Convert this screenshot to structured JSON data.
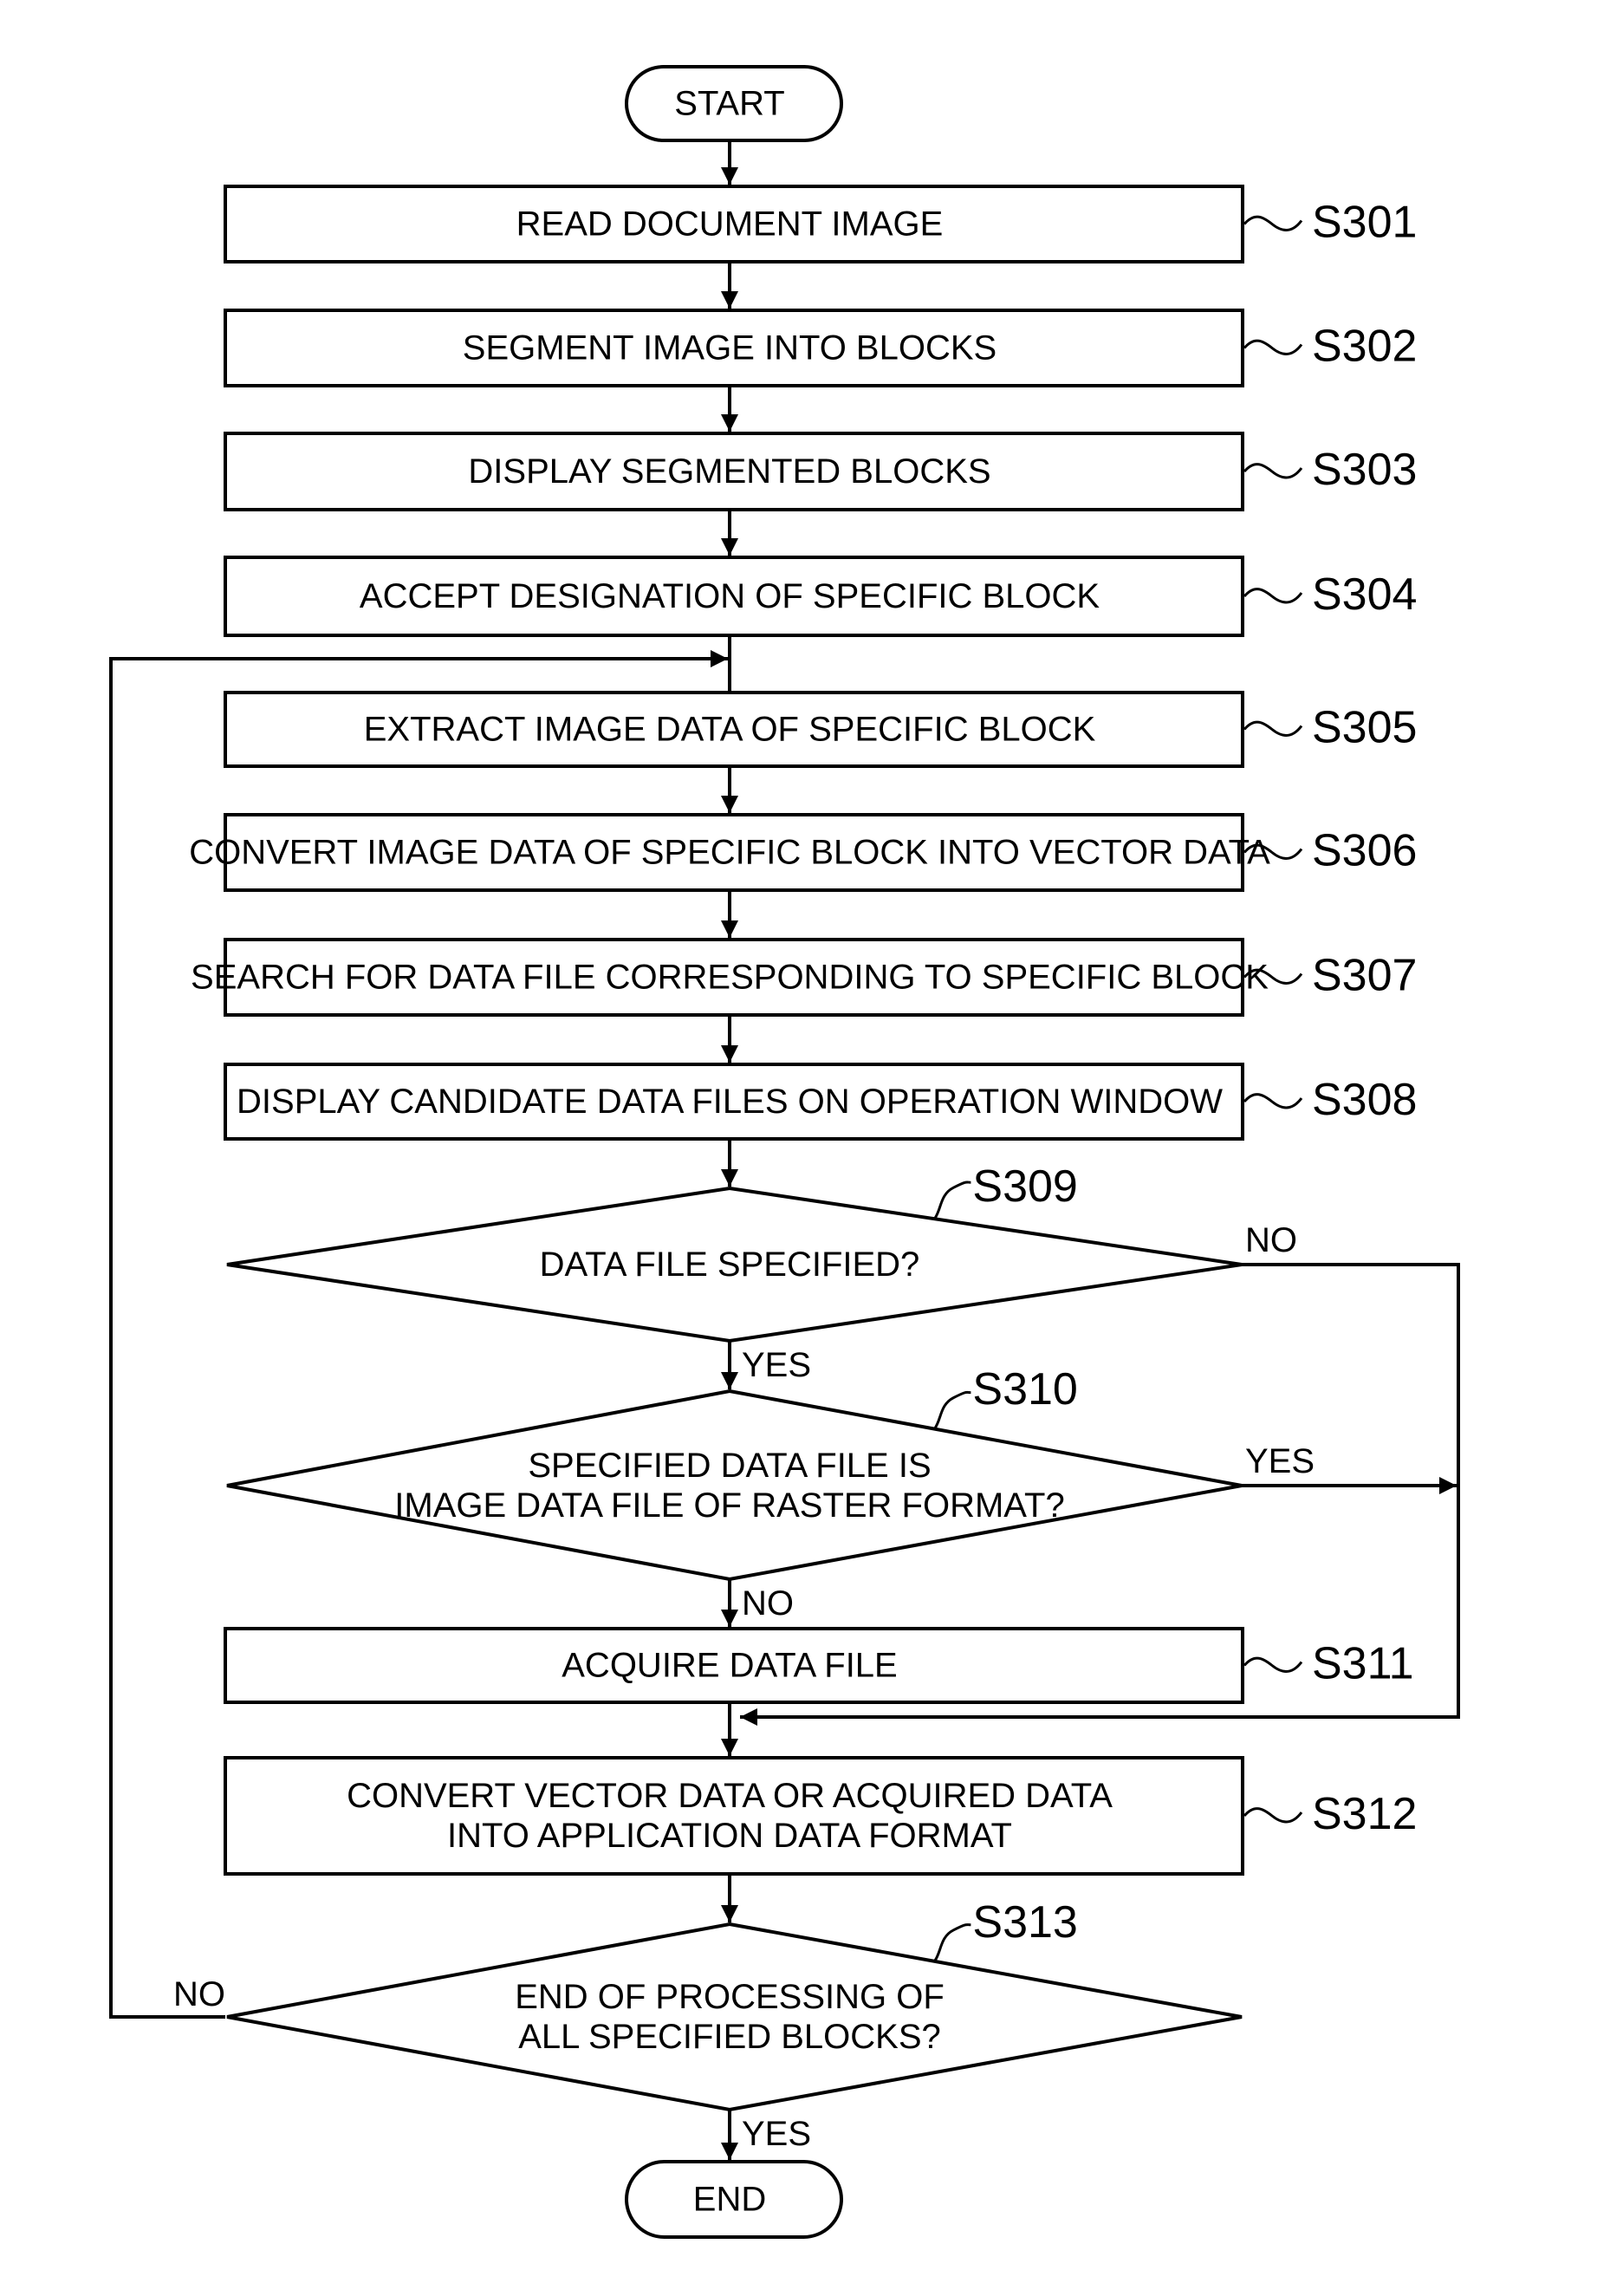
{
  "flowchart": {
    "terminals": {
      "start": "START",
      "end": "END"
    },
    "steps": [
      {
        "id": "S301",
        "lines": [
          "READ DOCUMENT IMAGE"
        ]
      },
      {
        "id": "S302",
        "lines": [
          "SEGMENT IMAGE INTO BLOCKS"
        ]
      },
      {
        "id": "S303",
        "lines": [
          "DISPLAY SEGMENTED BLOCKS"
        ]
      },
      {
        "id": "S304",
        "lines": [
          "ACCEPT DESIGNATION OF SPECIFIC BLOCK"
        ]
      },
      {
        "id": "S305",
        "lines": [
          "EXTRACT IMAGE DATA OF SPECIFIC BLOCK"
        ]
      },
      {
        "id": "S306",
        "lines": [
          "CONVERT IMAGE DATA OF SPECIFIC BLOCK INTO VECTOR DATA"
        ]
      },
      {
        "id": "S307",
        "lines": [
          "SEARCH FOR DATA FILE CORRESPONDING TO SPECIFIC BLOCK"
        ]
      },
      {
        "id": "S308",
        "lines": [
          "DISPLAY CANDIDATE DATA FILES ON OPERATION WINDOW"
        ]
      },
      {
        "id": "S311",
        "lines": [
          "ACQUIRE DATA FILE"
        ]
      },
      {
        "id": "S312",
        "lines": [
          "CONVERT VECTOR DATA OR ACQUIRED DATA",
          "INTO APPLICATION DATA FORMAT"
        ]
      }
    ],
    "decisions": [
      {
        "id": "S309",
        "lines": [
          "DATA FILE SPECIFIED?"
        ],
        "yes": "YES",
        "no": "NO"
      },
      {
        "id": "S310",
        "lines": [
          "SPECIFIED DATA FILE IS",
          "IMAGE DATA FILE OF RASTER FORMAT?"
        ],
        "yes": "YES",
        "no": "NO"
      },
      {
        "id": "S313",
        "lines": [
          "END OF PROCESSING OF",
          "ALL SPECIFIED BLOCKS?"
        ],
        "yes": "YES",
        "no": "NO"
      }
    ]
  }
}
